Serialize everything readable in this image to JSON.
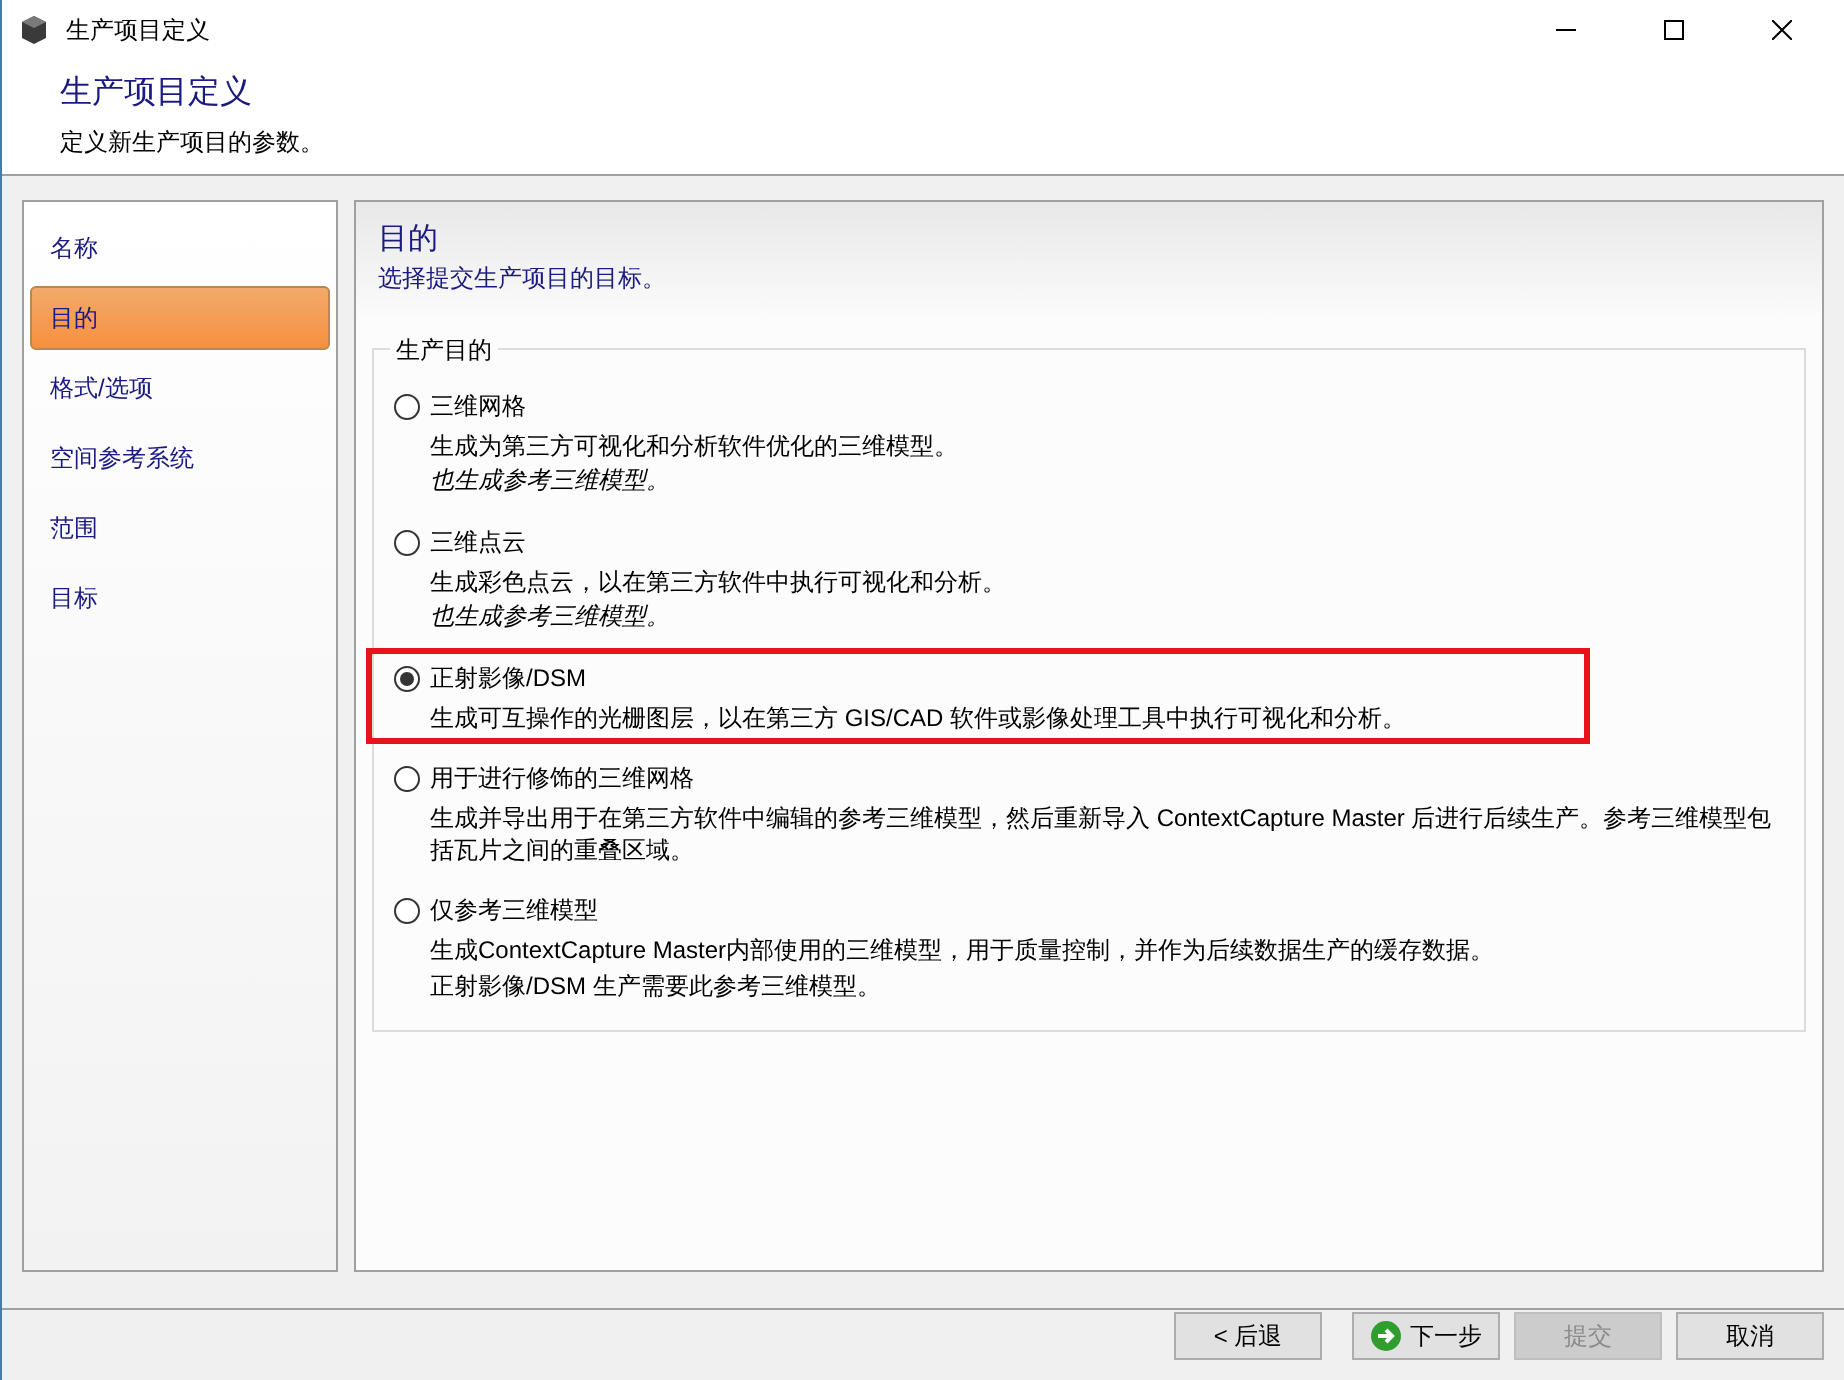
{
  "window": {
    "title": "生产项目定义"
  },
  "header": {
    "title": "生产项目定义",
    "subtitle": "定义新生产项目的参数。"
  },
  "sidebar": {
    "items": [
      {
        "label": "名称",
        "selected": false
      },
      {
        "label": "目的",
        "selected": true
      },
      {
        "label": "格式/选项",
        "selected": false
      },
      {
        "label": "空间参考系统",
        "selected": false
      },
      {
        "label": "范围",
        "selected": false
      },
      {
        "label": "目标",
        "selected": false
      }
    ]
  },
  "page": {
    "title": "目的",
    "subtitle": "选择提交生产项目的目标。"
  },
  "group": {
    "legend": "生产目的",
    "options": [
      {
        "label": "三维网格",
        "selected": false,
        "highlighted": false,
        "lines": [
          {
            "kind": "text",
            "text": "生成为第三方可视化和分析软件优化的三维模型。"
          },
          {
            "kind": "note",
            "text": "也生成参考三维模型。"
          }
        ]
      },
      {
        "label": "三维点云",
        "selected": false,
        "highlighted": false,
        "lines": [
          {
            "kind": "text",
            "text": "生成彩色点云，以在第三方软件中执行可视化和分析。"
          },
          {
            "kind": "note",
            "text": "也生成参考三维模型。"
          }
        ]
      },
      {
        "label": "正射影像/DSM",
        "selected": true,
        "highlighted": true,
        "lines": [
          {
            "kind": "text",
            "text": "生成可互操作的光栅图层，以在第三方 GIS/CAD 软件或影像处理工具中执行可视化和分析。"
          }
        ]
      },
      {
        "label": "用于进行修饰的三维网格",
        "selected": false,
        "highlighted": false,
        "lines": [
          {
            "kind": "text",
            "text": "生成并导出用于在第三方软件中编辑的参考三维模型，然后重新导入 ContextCapture Master 后进行后续生产。参考三维模型包括瓦片之间的重叠区域。"
          }
        ]
      },
      {
        "label": "仅参考三维模型",
        "selected": false,
        "highlighted": false,
        "lines": [
          {
            "kind": "text",
            "text": "生成ContextCapture Master内部使用的三维模型，用于质量控制，并作为后续数据生产的缓存数据。"
          },
          {
            "kind": "text",
            "text": "正射影像/DSM 生产需要此参考三维模型。"
          }
        ]
      }
    ]
  },
  "buttons": [
    {
      "kind": "back",
      "label": "< 后退",
      "disabled": false
    },
    {
      "kind": "next",
      "label": "下一步",
      "disabled": false
    },
    {
      "kind": "plain",
      "label": "提交",
      "disabled": true
    },
    {
      "kind": "plain",
      "label": "取消",
      "disabled": false
    }
  ]
}
